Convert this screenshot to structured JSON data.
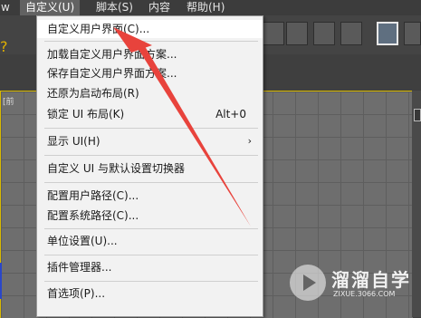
{
  "menubar": {
    "items": [
      {
        "label": "w"
      },
      {
        "label": "自定义(U)"
      },
      {
        "label": "脚本(S)"
      },
      {
        "label": "内容"
      },
      {
        "label": "帮助(H)"
      }
    ]
  },
  "viewport": {
    "label": "[前"
  },
  "dropdown": {
    "items": [
      {
        "label": "自定义用户界面(C)...",
        "shortcut": ""
      },
      {
        "label": "加载自定义用户界面方案...",
        "shortcut": ""
      },
      {
        "label": "保存自定义用户界面方案...",
        "shortcut": ""
      },
      {
        "label": "还原为启动布局(R)",
        "shortcut": ""
      },
      {
        "label": "锁定 UI 布局(K)",
        "shortcut": "Alt+0"
      },
      {
        "label": "显示 UI(H)",
        "shortcut": ""
      },
      {
        "label": "自定义 UI 与默认设置切换器",
        "shortcut": ""
      },
      {
        "label": "配置用户路径(C)...",
        "shortcut": ""
      },
      {
        "label": "配置系统路径(C)...",
        "shortcut": ""
      },
      {
        "label": "单位设置(U)...",
        "shortcut": ""
      },
      {
        "label": "插件管理器...",
        "shortcut": ""
      },
      {
        "label": "首选项(P)...",
        "shortcut": ""
      }
    ],
    "submenu_arrow": "›"
  },
  "watermark": {
    "title": "溜溜自学",
    "subtitle": "ZIXUE.3066.COM"
  },
  "colors": {
    "accent_arrow": "#e8433c",
    "viewport_border": "#d8b900"
  }
}
